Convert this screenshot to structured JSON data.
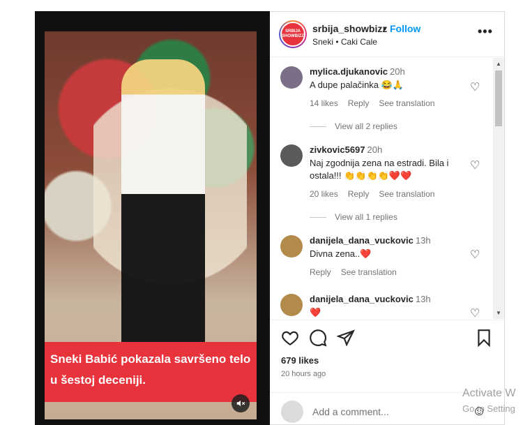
{
  "post": {
    "caption_overlay": "Sneki Babić pokazala savršeno telo u šestoj deceniji.",
    "mute_icon": "speaker-muted-icon"
  },
  "header": {
    "avatar_text": "SRBIJA SHOWBIZZ",
    "username": "srbija_showbizz",
    "dot": "•",
    "follow_label": "Follow",
    "subtitle": "Sneki • Caki Cale",
    "more_label": "•••"
  },
  "comments": [
    {
      "username": "mylica.djukanovic",
      "time": "20h",
      "text": "A dupe palačinka 😂🙏",
      "likes": "14 likes",
      "reply": "Reply",
      "translate": "See translation",
      "view_replies": "View all 2 replies",
      "avatar_color": "#7a6f86"
    },
    {
      "username": "zivkovic5697",
      "time": "20h",
      "text": "Naj zgodnija zena na estradi. Bila i ostala!!! 👏👏👏👏❤️❤️",
      "likes": "20 likes",
      "reply": "Reply",
      "translate": "See translation",
      "view_replies": "View all 1 replies",
      "avatar_color": "#5a5a5a"
    },
    {
      "username": "danijela_dana_vuckovic",
      "time": "13h",
      "text": "Divna zena..❤️",
      "reply": "Reply",
      "translate": "See translation",
      "avatar_color": "#b28a4a"
    },
    {
      "username": "danijela_dana_vuckovic",
      "time": "13h",
      "text": "❤️",
      "avatar_color": "#b28a4a"
    }
  ],
  "actions": {
    "like_icon": "♡",
    "comment_icon": "◯",
    "share_icon": "➢",
    "save_icon": "▯",
    "likes": "679 likes",
    "ago": "20 hours ago"
  },
  "add_comment": {
    "placeholder": "Add a comment...",
    "emoji_icon": "☺"
  },
  "watermark": {
    "line1": "Activate W",
    "line2": "Go to Setting"
  }
}
